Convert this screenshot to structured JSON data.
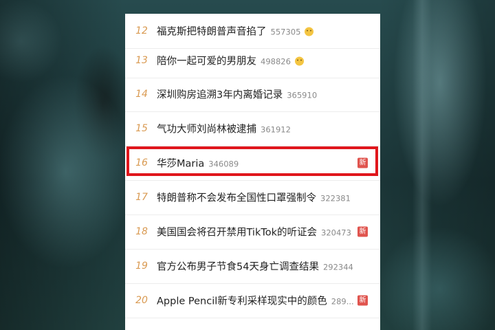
{
  "trending": {
    "items": [
      {
        "rank": "12",
        "title": "福克斯把特朗普声音掐了",
        "count": "557305",
        "emoji": "grin-emoji",
        "badge": ""
      },
      {
        "rank": "13",
        "title": "陪你一起可爱的男朋友",
        "count": "498826",
        "emoji": "cute-emoji",
        "badge": ""
      },
      {
        "rank": "14",
        "title": "深圳购房追溯3年内离婚记录",
        "count": "365910",
        "emoji": "",
        "badge": ""
      },
      {
        "rank": "15",
        "title": "气功大师刘尚林被逮捕",
        "count": "361912",
        "emoji": "",
        "badge": ""
      },
      {
        "rank": "16",
        "title": "华莎Maria",
        "count": "346089",
        "emoji": "",
        "badge": "新"
      },
      {
        "rank": "17",
        "title": "特朗普称不会发布全国性口罩强制令",
        "count": "322381",
        "emoji": "",
        "badge": ""
      },
      {
        "rank": "18",
        "title": "美国国会将召开禁用TikTok的听证会",
        "count": "320473",
        "emoji": "",
        "badge": "新"
      },
      {
        "rank": "19",
        "title": "官方公布男子节食54天身亡调查结果",
        "count": "292344",
        "emoji": "",
        "badge": ""
      },
      {
        "rank": "20",
        "title": "Apple Pencil新专利采样现实中的颜色",
        "count": "289...",
        "emoji": "",
        "badge": "新"
      }
    ],
    "highlighted_rank": "16"
  },
  "colors": {
    "rank": "#d99a52",
    "badge": "#e0544e",
    "highlight_border": "#e0161c",
    "backdrop": "#1d3a3d"
  }
}
